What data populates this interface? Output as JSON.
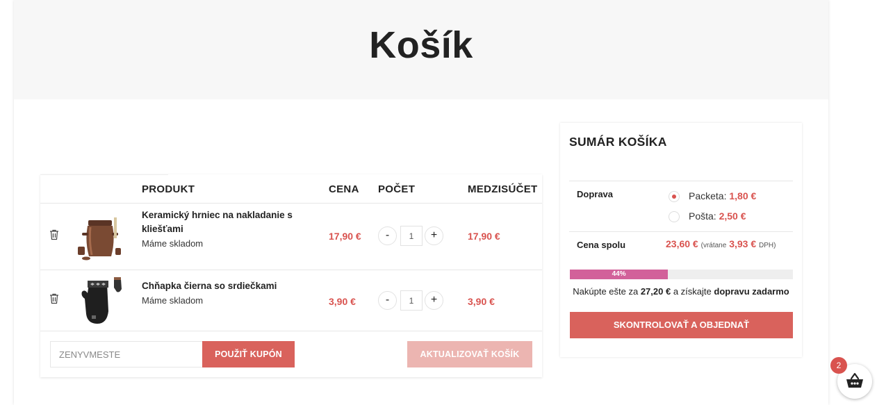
{
  "page": {
    "title": "Košík"
  },
  "cart": {
    "headers": {
      "product": "PRODUKT",
      "price": "CENA",
      "quantity": "POČET",
      "subtotal": "MEDZISÚČET"
    },
    "items": [
      {
        "name_line1": "Keramický hrniec na nakladanie s",
        "name_line2": "kliešťami",
        "stock": "Máme skladom",
        "price": "17,90 €",
        "qty": "1",
        "subtotal": "17,90 €",
        "icon": "ceramic-pot-icon"
      },
      {
        "name_line1": "Chňapka čierna so srdiečkami",
        "name_line2": "",
        "stock": "Máme skladom",
        "price": "3,90 €",
        "qty": "1",
        "subtotal": "3,90 €",
        "icon": "oven-mitt-icon"
      }
    ],
    "qty_minus": "-",
    "qty_plus": "+",
    "coupon_placeholder": "ZENYVMESTE",
    "apply_coupon": "POUŽIŤ KUPÓN",
    "update_cart": "AKTUALIZOVAŤ KOŠÍK"
  },
  "summary": {
    "title": "SUMÁR KOŠÍKA",
    "shipping_label": "Doprava",
    "shipping_options": [
      {
        "name": "Packeta:",
        "price": "1,80 €",
        "selected": true
      },
      {
        "name": "Pošta:",
        "price": "2,50 €",
        "selected": false
      }
    ],
    "total_label": "Cena spolu",
    "total_price": "23,60 €",
    "vat_prefix": "(vrátane",
    "vat_amount": "3,93 €",
    "vat_suffix": "DPH)",
    "progress_percent": 44,
    "progress_label": "44%",
    "progress_text_1": "Nakúpte ešte za",
    "progress_amount": "27,20 €",
    "progress_text_2": "a získajte",
    "progress_text_3": "dopravu zadarmo",
    "checkout": "SKONTROLOVAŤ A OBJEDNAŤ"
  },
  "basket": {
    "count": "2",
    "icon": "basket-icon"
  },
  "colors": {
    "accent": "#d9625c",
    "price": "#d9534f",
    "progress": "#d2619a",
    "update_button": "#ecb5b1",
    "hero_bg": "#f7f7f7"
  }
}
